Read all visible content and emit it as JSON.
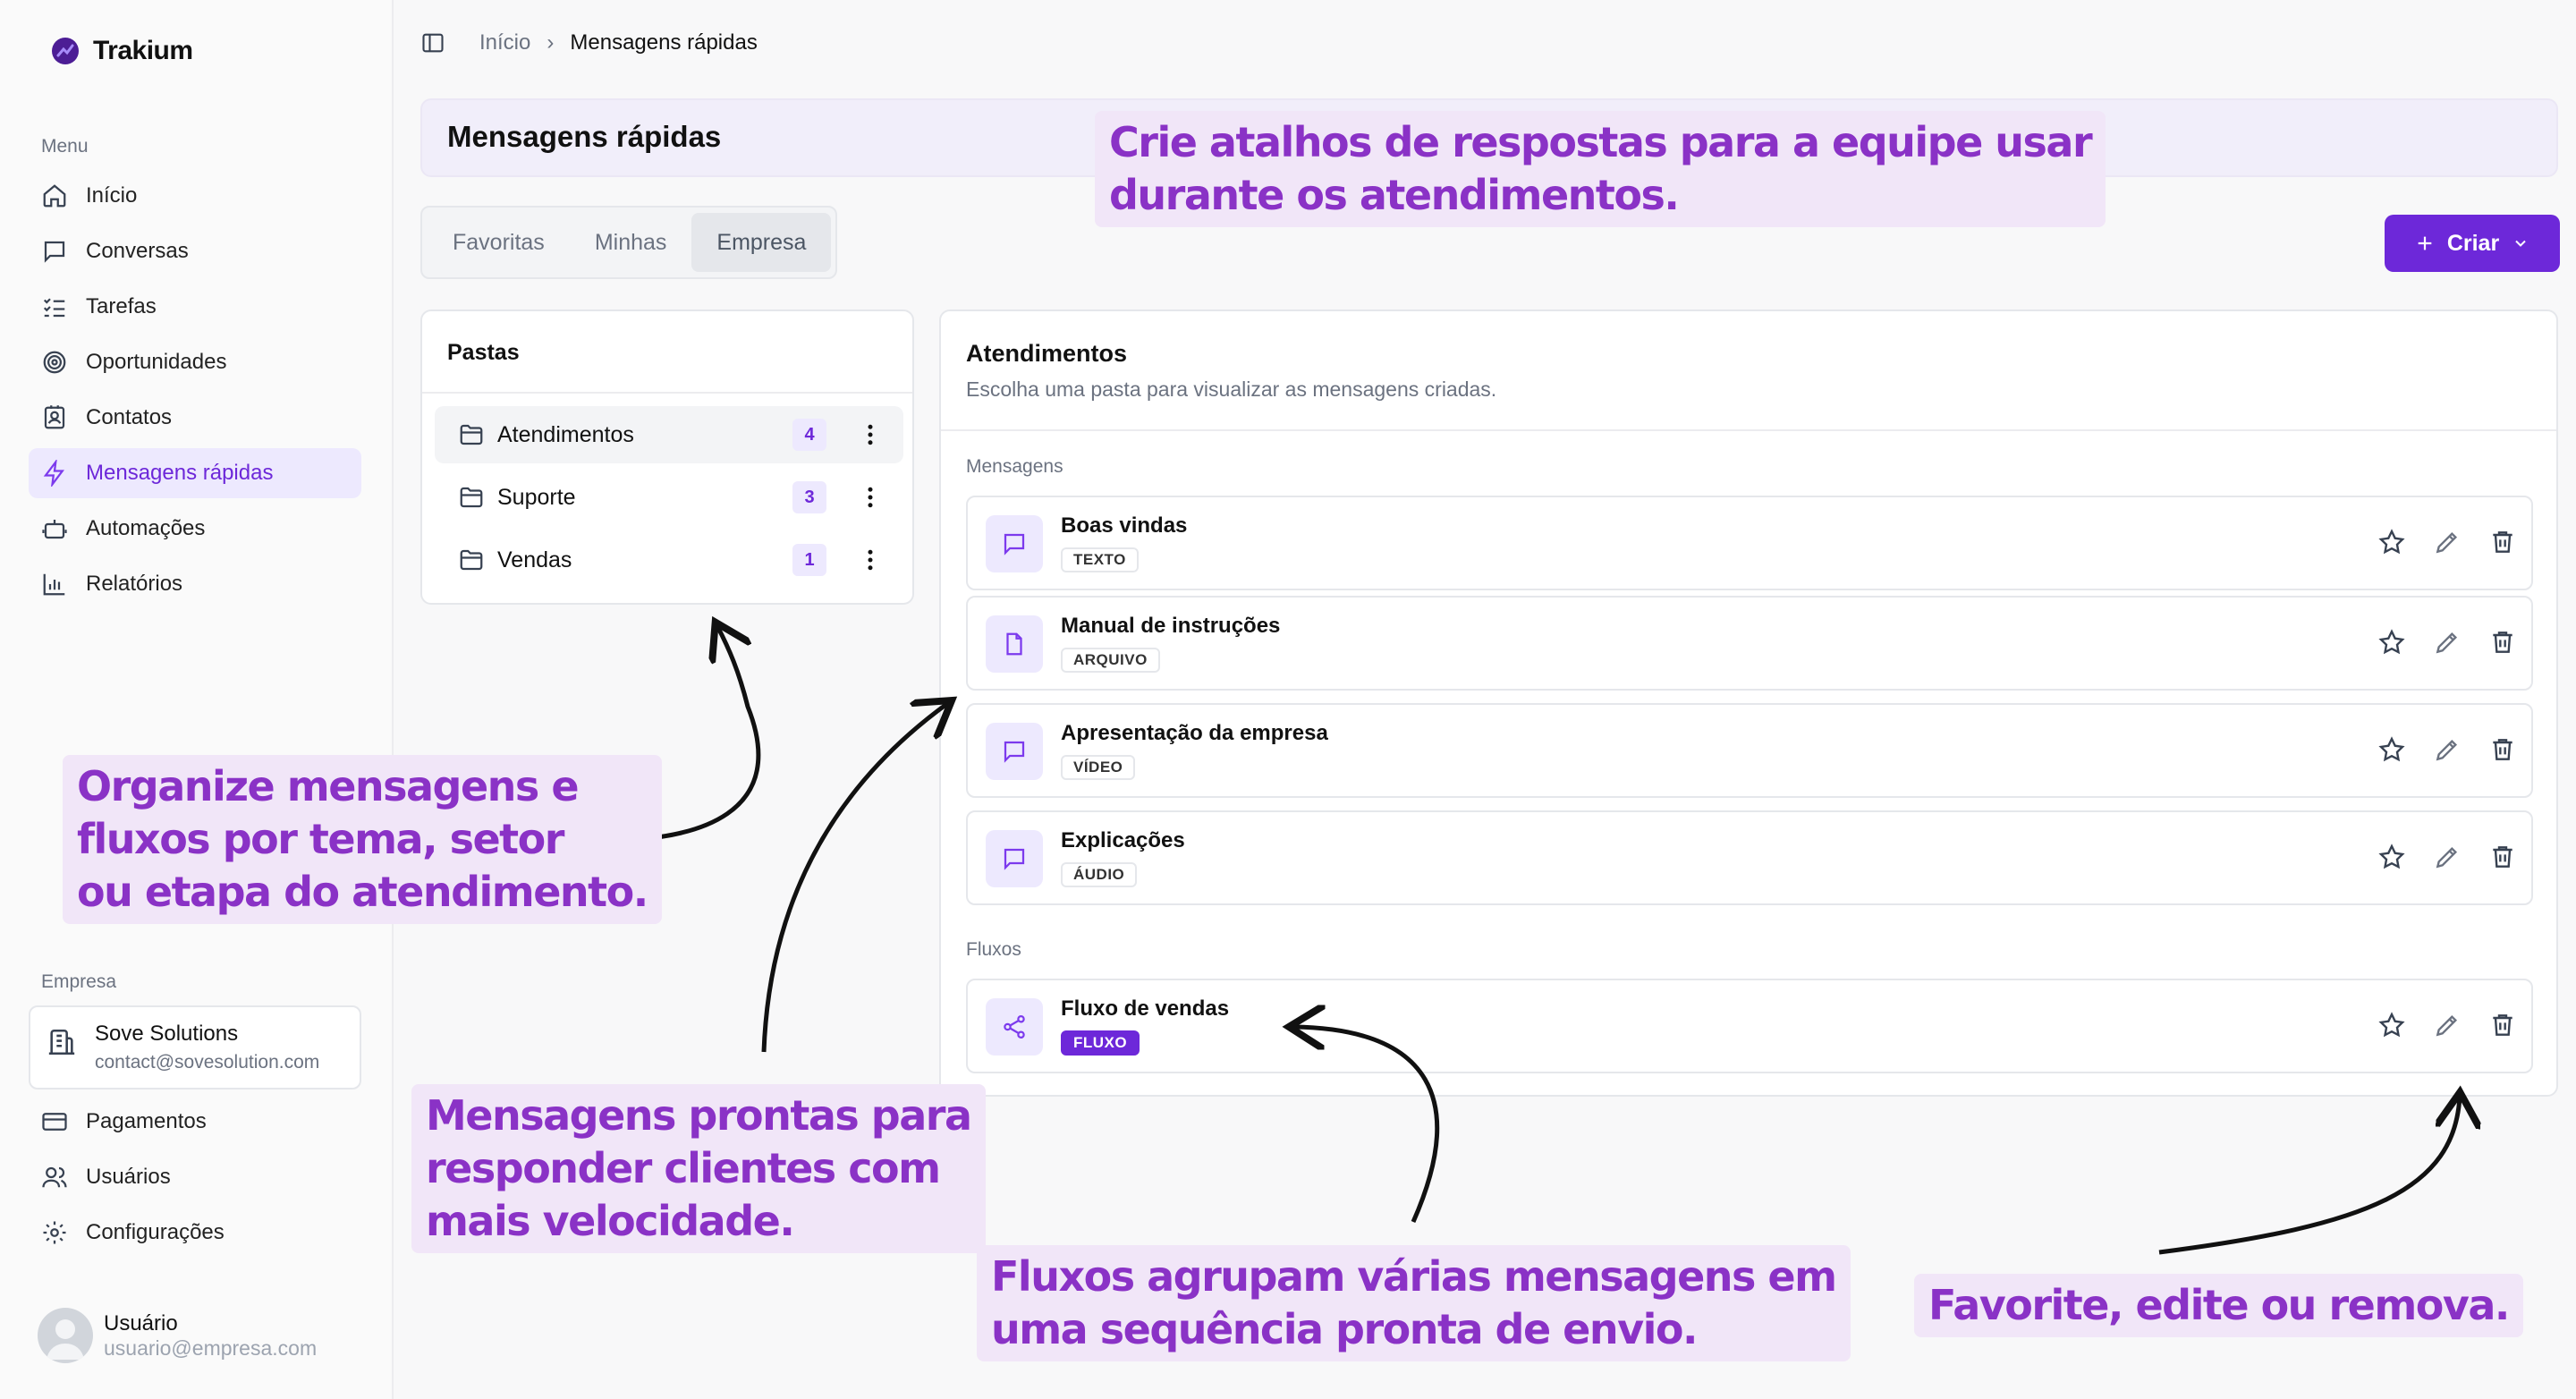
{
  "app": {
    "name": "Trakium"
  },
  "sidebar": {
    "menu_label": "Menu",
    "items": [
      {
        "label": "Início",
        "icon": "home-icon"
      },
      {
        "label": "Conversas",
        "icon": "chat-icon"
      },
      {
        "label": "Tarefas",
        "icon": "tasks-icon"
      },
      {
        "label": "Oportunidades",
        "icon": "target-icon"
      },
      {
        "label": "Contatos",
        "icon": "contact-icon"
      },
      {
        "label": "Mensagens rápidas",
        "icon": "lightning-icon",
        "active": true
      },
      {
        "label": "Automações",
        "icon": "bot-icon"
      },
      {
        "label": "Relatórios",
        "icon": "chart-icon"
      }
    ],
    "company_label": "Empresa",
    "company": {
      "name": "Sove Solutions",
      "email": "contact@sovesolution.com"
    },
    "company_items": [
      {
        "label": "Pagamentos",
        "icon": "card-icon"
      },
      {
        "label": "Usuários",
        "icon": "users-icon"
      },
      {
        "label": "Configurações",
        "icon": "gear-icon"
      }
    ],
    "user": {
      "name": "Usuário",
      "email": "usuario@empresa.com"
    }
  },
  "breadcrumb": {
    "home": "Início",
    "current": "Mensagens rápidas"
  },
  "page": {
    "title": "Mensagens rápidas"
  },
  "tabs": [
    {
      "label": "Favoritas"
    },
    {
      "label": "Minhas"
    },
    {
      "label": "Empresa",
      "active": true
    }
  ],
  "create_button": {
    "label": "Criar"
  },
  "folders": {
    "title": "Pastas",
    "items": [
      {
        "name": "Atendimentos",
        "count": "4",
        "active": true
      },
      {
        "name": "Suporte",
        "count": "3"
      },
      {
        "name": "Vendas",
        "count": "1"
      }
    ]
  },
  "messages_panel": {
    "title": "Atendimentos",
    "subtitle": "Escolha uma pasta para visualizar as mensagens criadas.",
    "messages_label": "Mensagens",
    "messages": [
      {
        "title": "Boas vindas",
        "type": "TEXTO",
        "icon": "message-icon"
      },
      {
        "title": "Manual de instruções",
        "type": "ARQUIVO",
        "icon": "file-icon"
      },
      {
        "title": "Apresentação da empresa",
        "type": "VÍDEO",
        "icon": "message-icon"
      },
      {
        "title": "Explicações",
        "type": "ÁUDIO",
        "icon": "message-icon"
      }
    ],
    "flows_label": "Fluxos",
    "flows": [
      {
        "title": "Fluxo de vendas",
        "type": "FLUXO",
        "icon": "share-icon"
      }
    ]
  },
  "annotations": {
    "top": [
      "Crie atalhos de respostas para a equipe usar",
      "durante os atendimentos."
    ],
    "folders": [
      "Organize mensagens e",
      "fluxos por tema, setor",
      "ou etapa do atendimento."
    ],
    "messages": [
      "Mensagens prontas para",
      "responder clientes com",
      "mais velocidade."
    ],
    "flows": [
      "Fluxos agrupam várias mensagens em",
      "uma sequência pronta de envio."
    ],
    "actions": [
      "Favorite, edite ou remova."
    ]
  },
  "colors": {
    "accent": "#6d28d9",
    "annotation_text": "#8a32c6",
    "annotation_bg": "#f1e6f8"
  }
}
